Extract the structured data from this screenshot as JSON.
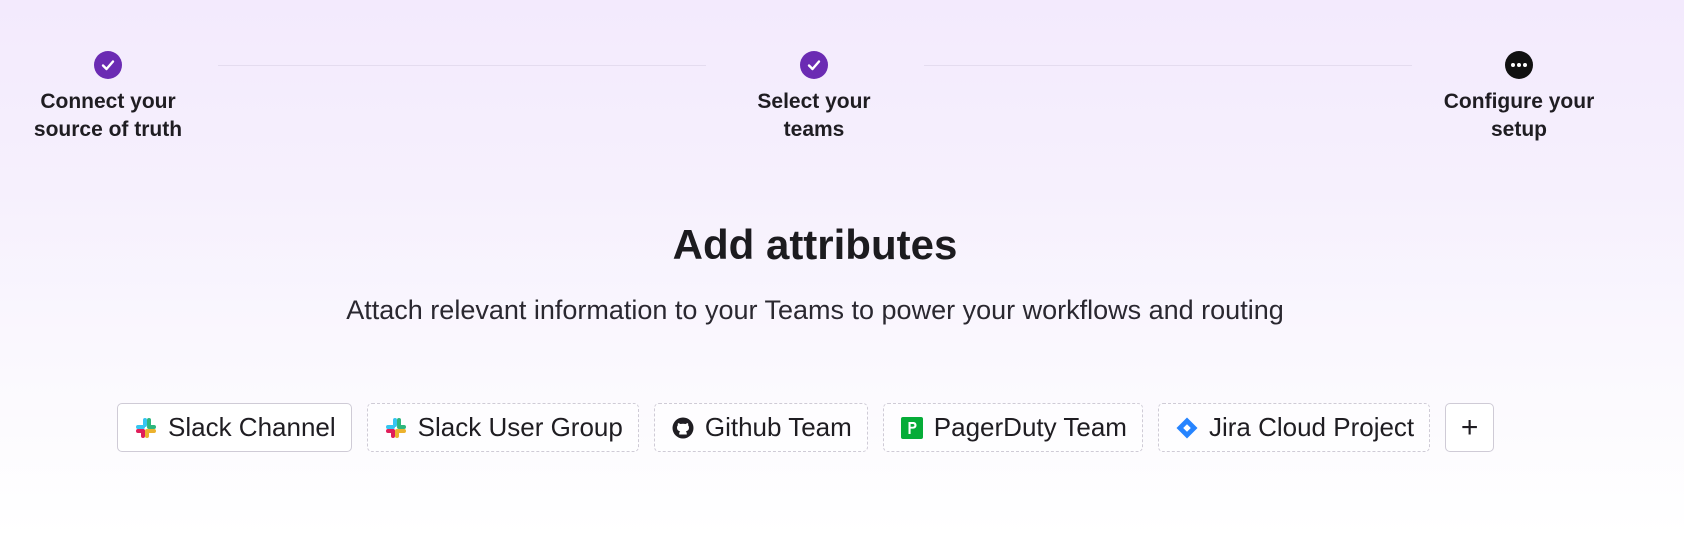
{
  "stepper": {
    "steps": [
      {
        "label": "Connect your\nsource of truth",
        "status": "complete",
        "icon": "check-icon"
      },
      {
        "label": "Select your\nteams",
        "status": "complete",
        "icon": "check-icon"
      },
      {
        "label": "Configure your\nsetup",
        "status": "in-progress",
        "icon": "ellipsis-icon"
      }
    ]
  },
  "main": {
    "title": "Add attributes",
    "subtitle": "Attach relevant information to your Teams to power your workflows and routing"
  },
  "attributes": {
    "items": [
      {
        "label": "Slack Channel",
        "icon": "slack-icon",
        "selected": true
      },
      {
        "label": "Slack User Group",
        "icon": "slack-icon",
        "selected": false
      },
      {
        "label": "Github Team",
        "icon": "github-icon",
        "selected": false
      },
      {
        "label": "PagerDuty Team",
        "icon": "pagerduty-icon",
        "selected": false
      },
      {
        "label": "Jira Cloud Project",
        "icon": "jira-icon",
        "selected": false
      }
    ],
    "add_label": "+"
  },
  "colors": {
    "accent": "#6b2bb3",
    "pending": "#111111",
    "pagerduty": "#06ac38",
    "jira": "#2684ff"
  }
}
